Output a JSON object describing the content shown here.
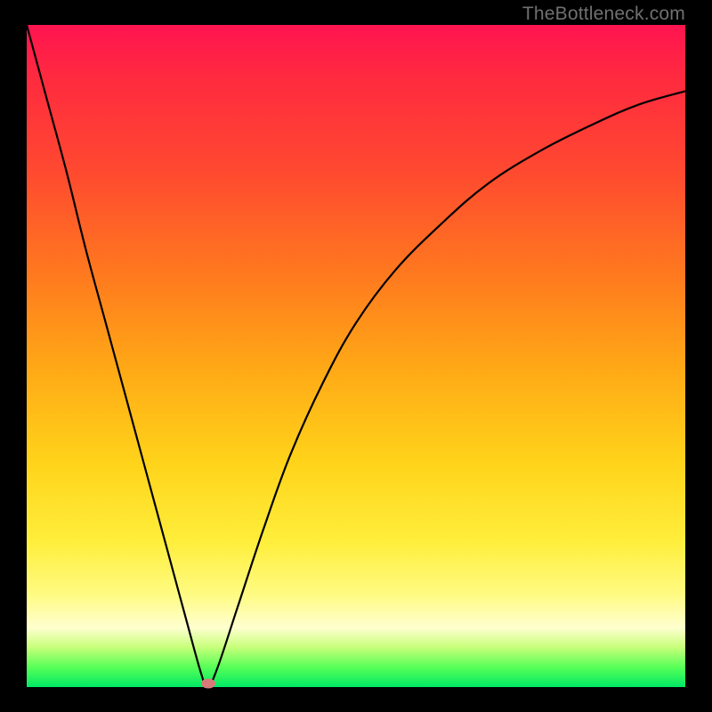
{
  "watermark": "TheBottleneck.com",
  "colors": {
    "frame": "#000000",
    "curve": "#000000",
    "marker": "#d87a7a"
  },
  "chart_data": {
    "type": "line",
    "title": "",
    "xlabel": "",
    "ylabel": "",
    "xlim": [
      0,
      100
    ],
    "ylim": [
      0,
      100
    ],
    "grid": false,
    "legend": false,
    "note": "Axes are unlabeled in the source image; values are normalized 0–100 estimates read from pixel positions.",
    "series": [
      {
        "name": "bottleneck-curve",
        "x": [
          0,
          3,
          6,
          9,
          12,
          15,
          18,
          21,
          24,
          26.5,
          27.5,
          29,
          32,
          36,
          40,
          45,
          50,
          56,
          63,
          70,
          78,
          86,
          93,
          100
        ],
        "y": [
          100,
          89,
          78,
          66,
          55,
          44,
          33,
          22,
          11,
          2,
          0,
          3,
          12,
          24,
          35,
          46,
          55,
          63,
          70,
          76,
          81,
          85,
          88,
          90
        ]
      }
    ],
    "marker": {
      "x": 27.5,
      "y": 0.6,
      "shape": "ellipse"
    },
    "background_gradient": {
      "direction": "vertical",
      "stops": [
        {
          "pos": 0.0,
          "color": "#ff1450"
        },
        {
          "pos": 0.22,
          "color": "#ff4930"
        },
        {
          "pos": 0.52,
          "color": "#ffa916"
        },
        {
          "pos": 0.78,
          "color": "#ffee3b"
        },
        {
          "pos": 0.91,
          "color": "#ffffd0"
        },
        {
          "pos": 1.0,
          "color": "#00e865"
        }
      ]
    }
  }
}
